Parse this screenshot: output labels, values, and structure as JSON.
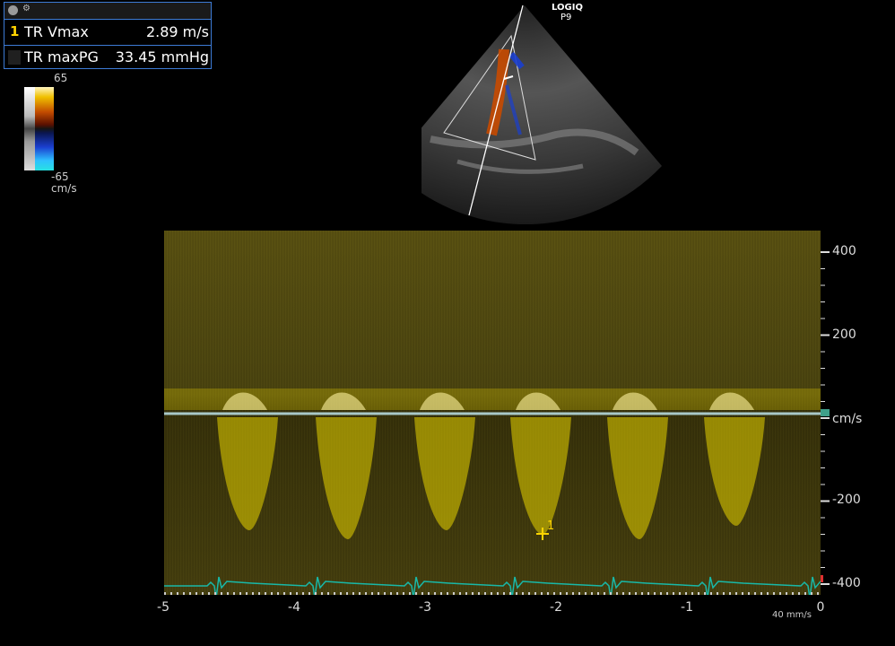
{
  "measurement_panel": {
    "rows": [
      {
        "index": "1",
        "name": "TR Vmax",
        "value": "2.89 m/s"
      },
      {
        "index": "",
        "name": "TR maxPG",
        "value": "33.45 mmHg"
      }
    ]
  },
  "color_scale": {
    "top": "65",
    "bottom": "-65",
    "unit": "cm/s"
  },
  "logo": {
    "line1": "LOGIQ",
    "line2": "P9"
  },
  "velocity_axis": {
    "labels": [
      "400",
      "200",
      "cm/s",
      "-200",
      "-400"
    ]
  },
  "time_axis": {
    "labels": [
      "-5",
      "-4",
      "-3",
      "-2",
      "-1",
      "0"
    ],
    "sweep_speed": "40 mm/s"
  },
  "cursor": {
    "label": "1"
  },
  "colors": {
    "spectrum": "#e8d400",
    "ecg": "#18b8a8",
    "baseline": "#a8c8c8",
    "panel_border": "#3d7bd6"
  }
}
